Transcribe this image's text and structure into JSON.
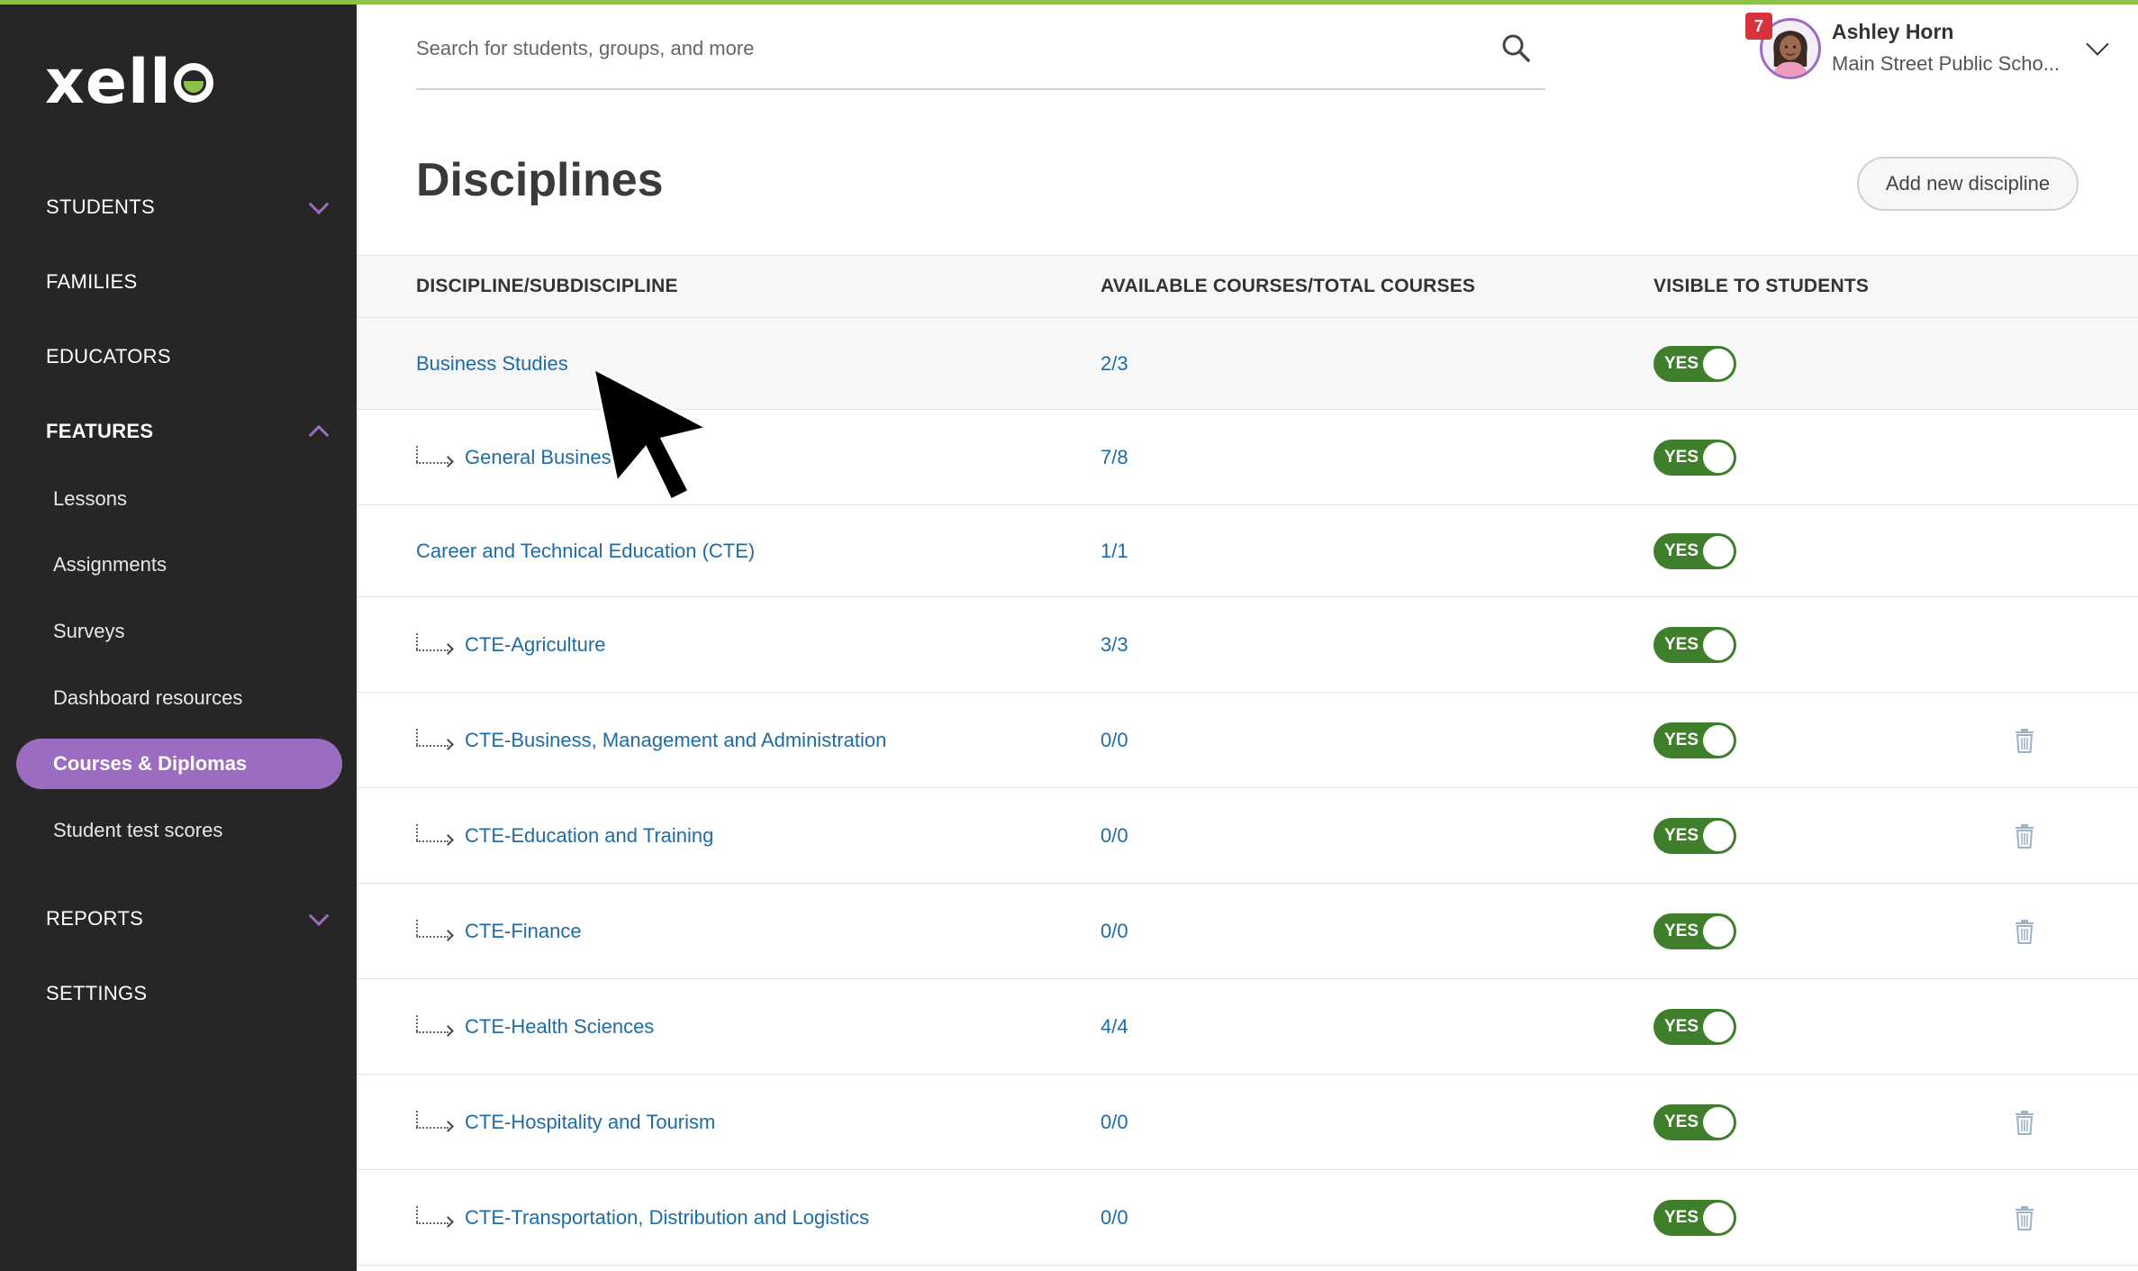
{
  "brand": {
    "logo_text": "xell",
    "accent": "#8bc34a",
    "nav_accent": "#9b6cc0"
  },
  "sidebar": {
    "sections": [
      {
        "label": "STUDENTS"
      },
      {
        "label": "FAMILIES"
      },
      {
        "label": "EDUCATORS"
      },
      {
        "label": "FEATURES"
      },
      {
        "label": "REPORTS"
      },
      {
        "label": "SETTINGS"
      }
    ],
    "features_items": [
      {
        "label": "Lessons"
      },
      {
        "label": "Assignments"
      },
      {
        "label": "Surveys"
      },
      {
        "label": "Dashboard resources"
      },
      {
        "label": "Courses & Diplomas"
      },
      {
        "label": "Student test scores"
      }
    ]
  },
  "search": {
    "placeholder": "Search for students, groups, and more"
  },
  "user": {
    "notifications": "7",
    "name": "Ashley Horn",
    "school": "Main Street Public Scho..."
  },
  "page": {
    "title": "Disciplines",
    "add_button": "Add new discipline"
  },
  "table": {
    "headers": {
      "name": "DISCIPLINE/SUBDISCIPLINE",
      "courses": "AVAILABLE COURSES/TOTAL COURSES",
      "visible": "VISIBLE TO STUDENTS"
    },
    "toggle_label": "YES",
    "rows": [
      {
        "name": "Business Studies",
        "courses": "2/3"
      },
      {
        "name": "General Business",
        "courses": "7/8"
      },
      {
        "name": "Career and Technical Education (CTE)",
        "courses": "1/1"
      },
      {
        "name": "CTE-Agriculture",
        "courses": "3/3"
      },
      {
        "name": "CTE-Business, Management and Administration",
        "courses": "0/0"
      },
      {
        "name": "CTE-Education and Training",
        "courses": "0/0"
      },
      {
        "name": "CTE-Finance",
        "courses": "0/0"
      },
      {
        "name": "CTE-Health Sciences",
        "courses": "4/4"
      },
      {
        "name": "CTE-Hospitality and Tourism",
        "courses": "0/0"
      },
      {
        "name": "CTE-Transportation, Distribution and Logistics",
        "courses": "0/0"
      }
    ]
  }
}
